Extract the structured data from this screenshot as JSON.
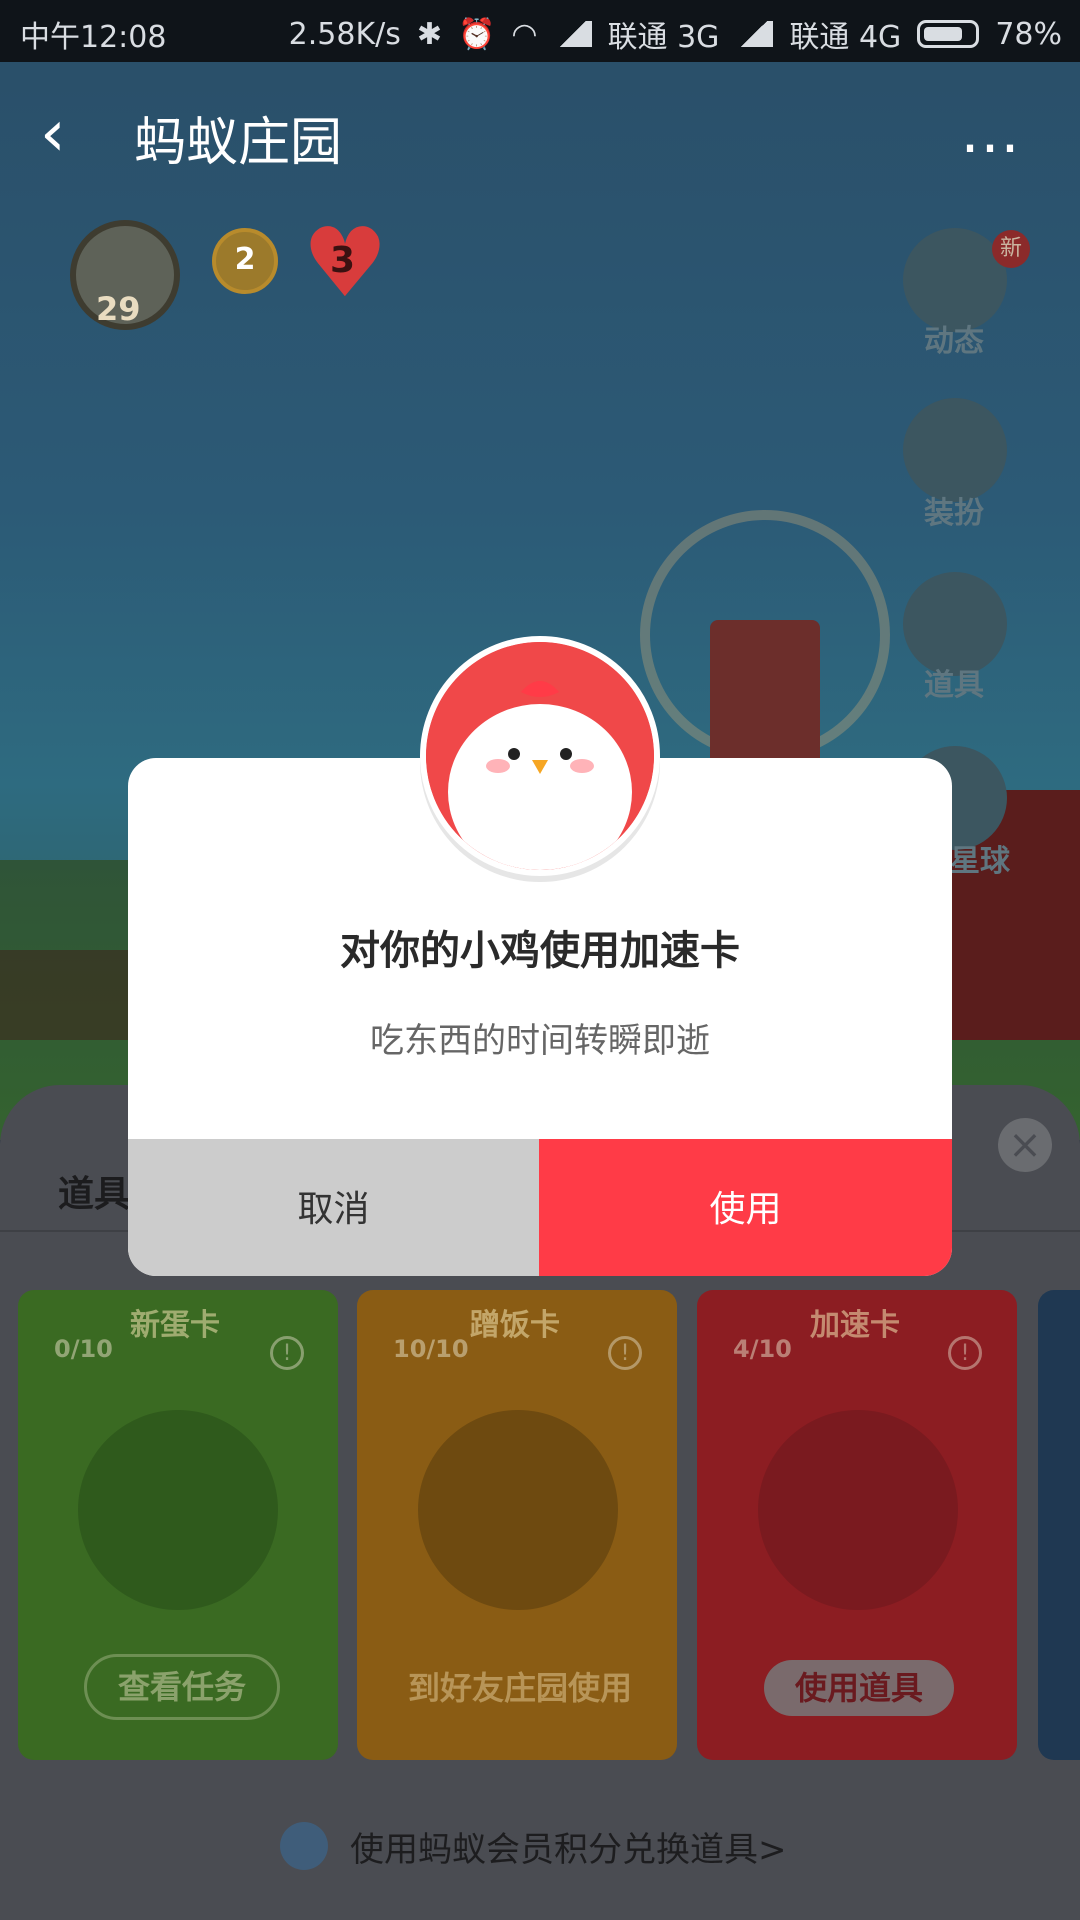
{
  "status_bar": {
    "time": "中午12:08",
    "speed": "2.58K/s",
    "carrier1": "联通 3G",
    "carrier2": "联通 4G",
    "battery": "78%"
  },
  "header": {
    "title": "蚂蚁庄园"
  },
  "profile": {
    "level": "29",
    "medal_count": "2",
    "heart_count": "3"
  },
  "side_menu": {
    "items": [
      {
        "label": "动态",
        "badge": "新"
      },
      {
        "label": "装扮"
      },
      {
        "label": "道具"
      },
      {
        "label": "星球"
      }
    ]
  },
  "panel": {
    "title": "道具",
    "cards": [
      {
        "name": "新蛋卡",
        "count": "0/10",
        "action": "查看任务"
      },
      {
        "name": "蹭饭卡",
        "count": "10/10",
        "action": "到好友庄园使用"
      },
      {
        "name": "加速卡",
        "count": "4/10",
        "action": "使用道具"
      }
    ],
    "exchange_link": "使用蚂蚁会员积分兑换道具>"
  },
  "dialog": {
    "title": "对你的小鸡使用加速卡",
    "subtitle": "吃东西的时间转瞬即逝",
    "cancel_label": "取消",
    "use_label": "使用"
  },
  "colors": {
    "accent": "#ff3b47",
    "cancel_bg": "#cccccc"
  }
}
